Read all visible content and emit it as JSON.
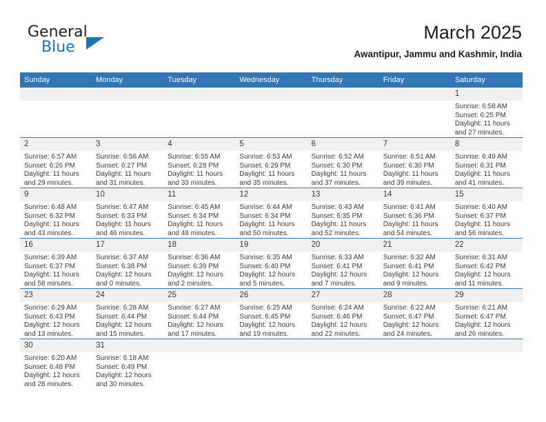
{
  "brand": {
    "name_top": "General",
    "name_bottom": "Blue",
    "accent_color": "#1b75bb"
  },
  "header": {
    "title": "March 2025",
    "subtitle": "Awantipur, Jammu and Kashmir, India"
  },
  "theme": {
    "header_blue": "#3075b4",
    "daynum_gray": "#f0f0f0",
    "text_color": "#3a3a3a"
  },
  "weekdays": [
    "Sunday",
    "Monday",
    "Tuesday",
    "Wednesday",
    "Thursday",
    "Friday",
    "Saturday"
  ],
  "labels": {
    "sunrise_prefix": "Sunrise: ",
    "sunset_prefix": "Sunset: ",
    "daylight_prefix": "Daylight: "
  },
  "weeks": [
    [
      {
        "day": "",
        "empty": true
      },
      {
        "day": "",
        "empty": true
      },
      {
        "day": "",
        "empty": true
      },
      {
        "day": "",
        "empty": true
      },
      {
        "day": "",
        "empty": true
      },
      {
        "day": "",
        "empty": true
      },
      {
        "day": "1",
        "sunrise": "Sunrise: 6:58 AM",
        "sunset": "Sunset: 6:25 PM",
        "daylight_line1": "Daylight: 11 hours",
        "daylight_line2": "and 27 minutes."
      }
    ],
    [
      {
        "day": "2",
        "sunrise": "Sunrise: 6:57 AM",
        "sunset": "Sunset: 6:26 PM",
        "daylight_line1": "Daylight: 11 hours",
        "daylight_line2": "and 29 minutes."
      },
      {
        "day": "3",
        "sunrise": "Sunrise: 6:56 AM",
        "sunset": "Sunset: 6:27 PM",
        "daylight_line1": "Daylight: 11 hours",
        "daylight_line2": "and 31 minutes."
      },
      {
        "day": "4",
        "sunrise": "Sunrise: 6:55 AM",
        "sunset": "Sunset: 6:28 PM",
        "daylight_line1": "Daylight: 11 hours",
        "daylight_line2": "and 33 minutes."
      },
      {
        "day": "5",
        "sunrise": "Sunrise: 6:53 AM",
        "sunset": "Sunset: 6:29 PM",
        "daylight_line1": "Daylight: 11 hours",
        "daylight_line2": "and 35 minutes."
      },
      {
        "day": "6",
        "sunrise": "Sunrise: 6:52 AM",
        "sunset": "Sunset: 6:30 PM",
        "daylight_line1": "Daylight: 11 hours",
        "daylight_line2": "and 37 minutes."
      },
      {
        "day": "7",
        "sunrise": "Sunrise: 6:51 AM",
        "sunset": "Sunset: 6:30 PM",
        "daylight_line1": "Daylight: 11 hours",
        "daylight_line2": "and 39 minutes."
      },
      {
        "day": "8",
        "sunrise": "Sunrise: 6:49 AM",
        "sunset": "Sunset: 6:31 PM",
        "daylight_line1": "Daylight: 11 hours",
        "daylight_line2": "and 41 minutes."
      }
    ],
    [
      {
        "day": "9",
        "sunrise": "Sunrise: 6:48 AM",
        "sunset": "Sunset: 6:32 PM",
        "daylight_line1": "Daylight: 11 hours",
        "daylight_line2": "and 43 minutes."
      },
      {
        "day": "10",
        "sunrise": "Sunrise: 6:47 AM",
        "sunset": "Sunset: 6:33 PM",
        "daylight_line1": "Daylight: 11 hours",
        "daylight_line2": "and 46 minutes."
      },
      {
        "day": "11",
        "sunrise": "Sunrise: 6:45 AM",
        "sunset": "Sunset: 6:34 PM",
        "daylight_line1": "Daylight: 11 hours",
        "daylight_line2": "and 48 minutes."
      },
      {
        "day": "12",
        "sunrise": "Sunrise: 6:44 AM",
        "sunset": "Sunset: 6:34 PM",
        "daylight_line1": "Daylight: 11 hours",
        "daylight_line2": "and 50 minutes."
      },
      {
        "day": "13",
        "sunrise": "Sunrise: 6:43 AM",
        "sunset": "Sunset: 6:35 PM",
        "daylight_line1": "Daylight: 11 hours",
        "daylight_line2": "and 52 minutes."
      },
      {
        "day": "14",
        "sunrise": "Sunrise: 6:41 AM",
        "sunset": "Sunset: 6:36 PM",
        "daylight_line1": "Daylight: 11 hours",
        "daylight_line2": "and 54 minutes."
      },
      {
        "day": "15",
        "sunrise": "Sunrise: 6:40 AM",
        "sunset": "Sunset: 6:37 PM",
        "daylight_line1": "Daylight: 11 hours",
        "daylight_line2": "and 56 minutes."
      }
    ],
    [
      {
        "day": "16",
        "sunrise": "Sunrise: 6:39 AM",
        "sunset": "Sunset: 6:37 PM",
        "daylight_line1": "Daylight: 11 hours",
        "daylight_line2": "and 58 minutes."
      },
      {
        "day": "17",
        "sunrise": "Sunrise: 6:37 AM",
        "sunset": "Sunset: 6:38 PM",
        "daylight_line1": "Daylight: 12 hours",
        "daylight_line2": "and 0 minutes."
      },
      {
        "day": "18",
        "sunrise": "Sunrise: 6:36 AM",
        "sunset": "Sunset: 6:39 PM",
        "daylight_line1": "Daylight: 12 hours",
        "daylight_line2": "and 2 minutes."
      },
      {
        "day": "19",
        "sunrise": "Sunrise: 6:35 AM",
        "sunset": "Sunset: 6:40 PM",
        "daylight_line1": "Daylight: 12 hours",
        "daylight_line2": "and 5 minutes."
      },
      {
        "day": "20",
        "sunrise": "Sunrise: 6:33 AM",
        "sunset": "Sunset: 6:41 PM",
        "daylight_line1": "Daylight: 12 hours",
        "daylight_line2": "and 7 minutes."
      },
      {
        "day": "21",
        "sunrise": "Sunrise: 6:32 AM",
        "sunset": "Sunset: 6:41 PM",
        "daylight_line1": "Daylight: 12 hours",
        "daylight_line2": "and 9 minutes."
      },
      {
        "day": "22",
        "sunrise": "Sunrise: 6:31 AM",
        "sunset": "Sunset: 6:42 PM",
        "daylight_line1": "Daylight: 12 hours",
        "daylight_line2": "and 11 minutes."
      }
    ],
    [
      {
        "day": "23",
        "sunrise": "Sunrise: 6:29 AM",
        "sunset": "Sunset: 6:43 PM",
        "daylight_line1": "Daylight: 12 hours",
        "daylight_line2": "and 13 minutes."
      },
      {
        "day": "24",
        "sunrise": "Sunrise: 6:28 AM",
        "sunset": "Sunset: 6:44 PM",
        "daylight_line1": "Daylight: 12 hours",
        "daylight_line2": "and 15 minutes."
      },
      {
        "day": "25",
        "sunrise": "Sunrise: 6:27 AM",
        "sunset": "Sunset: 6:44 PM",
        "daylight_line1": "Daylight: 12 hours",
        "daylight_line2": "and 17 minutes."
      },
      {
        "day": "26",
        "sunrise": "Sunrise: 6:25 AM",
        "sunset": "Sunset: 6:45 PM",
        "daylight_line1": "Daylight: 12 hours",
        "daylight_line2": "and 19 minutes."
      },
      {
        "day": "27",
        "sunrise": "Sunrise: 6:24 AM",
        "sunset": "Sunset: 6:46 PM",
        "daylight_line1": "Daylight: 12 hours",
        "daylight_line2": "and 22 minutes."
      },
      {
        "day": "28",
        "sunrise": "Sunrise: 6:22 AM",
        "sunset": "Sunset: 6:47 PM",
        "daylight_line1": "Daylight: 12 hours",
        "daylight_line2": "and 24 minutes."
      },
      {
        "day": "29",
        "sunrise": "Sunrise: 6:21 AM",
        "sunset": "Sunset: 6:47 PM",
        "daylight_line1": "Daylight: 12 hours",
        "daylight_line2": "and 26 minutes."
      }
    ],
    [
      {
        "day": "30",
        "sunrise": "Sunrise: 6:20 AM",
        "sunset": "Sunset: 6:48 PM",
        "daylight_line1": "Daylight: 12 hours",
        "daylight_line2": "and 28 minutes."
      },
      {
        "day": "31",
        "sunrise": "Sunrise: 6:18 AM",
        "sunset": "Sunset: 6:49 PM",
        "daylight_line1": "Daylight: 12 hours",
        "daylight_line2": "and 30 minutes."
      },
      {
        "day": "",
        "empty": true
      },
      {
        "day": "",
        "empty": true
      },
      {
        "day": "",
        "empty": true
      },
      {
        "day": "",
        "empty": true
      },
      {
        "day": "",
        "empty": true
      }
    ]
  ]
}
